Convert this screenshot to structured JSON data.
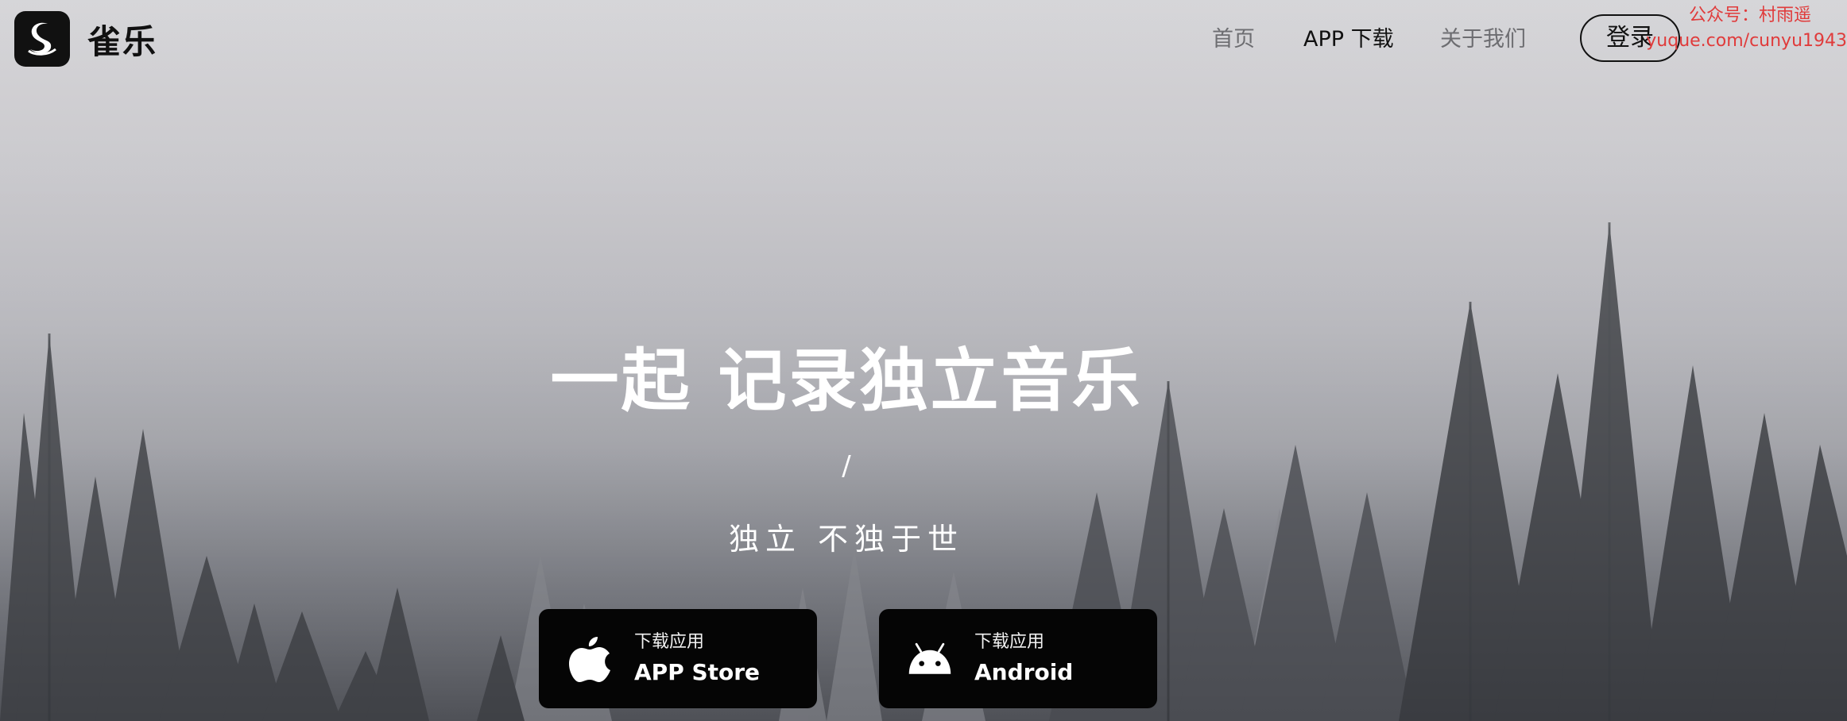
{
  "brand": {
    "name": "雀乐",
    "logo_icon": "swan-icon"
  },
  "nav": {
    "home": "首页",
    "app_download": "APP 下载",
    "about": "关于我们",
    "login": "登录"
  },
  "watermark": {
    "line1": "公众号：村雨遥",
    "line2": "yuque.com/cunyu1943"
  },
  "hero": {
    "title": "一起 记录独立音乐",
    "slash": "/",
    "subtitle": "独立 不独于世"
  },
  "downloads": {
    "ios": {
      "small": "下载应用",
      "big": "APP Store",
      "icon": "apple-icon"
    },
    "android": {
      "small": "下载应用",
      "big": "Android",
      "icon": "android-icon"
    }
  },
  "colors": {
    "nav_active": "#111111",
    "nav_inactive": "#6d6d71",
    "watermark": "#e03b3b",
    "button_bg": "#050505"
  }
}
